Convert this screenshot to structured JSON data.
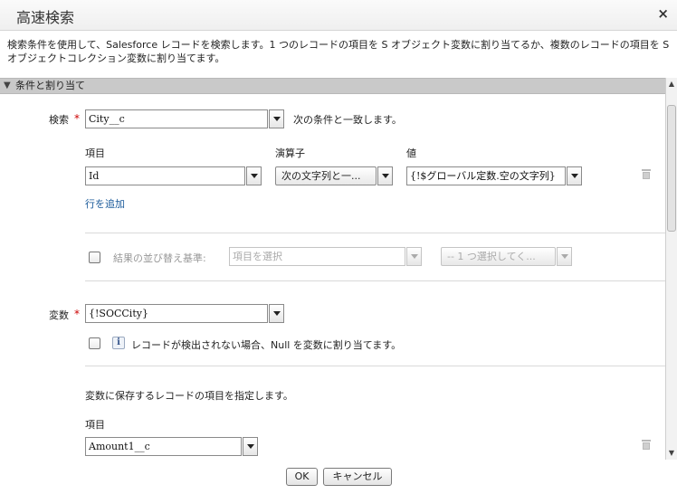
{
  "dialog": {
    "title": "高速検索",
    "close_glyph": "×",
    "description": "検索条件を使用して、Salesforce レコードを検索します。1 つのレコードの項目を S オブジェクト変数に割り当てるか、複数のレコードの項目を S オブジェクトコレクション変数に割り当てます。"
  },
  "section": {
    "toggle_glyph": "▼",
    "title": "条件と割り当て"
  },
  "lookup": {
    "label": "検索",
    "required_mark": "*",
    "object_value": "City__c",
    "condition_text": "次の条件と一致します。"
  },
  "conditions": {
    "headers": {
      "field": "項目",
      "operator": "演算子",
      "value": "値"
    },
    "rows": [
      {
        "field": "Id",
        "operator": "次の文字列と一...",
        "value": "{!$グローバル定数.空の文字列}"
      }
    ],
    "add_row_label": "行を追加"
  },
  "sort": {
    "label": "結果の並び替え基準:",
    "field_placeholder": "項目を選択",
    "order_placeholder": "-- 1 つ選択してく..."
  },
  "variable": {
    "label": "変数",
    "required_mark": "*",
    "value": "{!SOCCity}",
    "null_info_glyph": "i",
    "null_label": "レコードが検出されない場合、Null を変数に割り当てます。"
  },
  "fields_to_save": {
    "instruction": "変数に保存するレコードの項目を指定します。",
    "header": "項目",
    "rows": [
      {
        "field": "Amount1__c"
      }
    ]
  },
  "footer": {
    "ok_label": "OK",
    "cancel_label": "キャンセル"
  },
  "icons": {
    "close": "close-icon",
    "toggle": "triangle-down-icon",
    "dropdown": "chevron-down-icon",
    "delete": "trash-icon",
    "info": "info-icon"
  },
  "colors": {
    "required": "#cc0000",
    "link": "#1a5a9a",
    "section_bar": "#c9c9c9"
  }
}
